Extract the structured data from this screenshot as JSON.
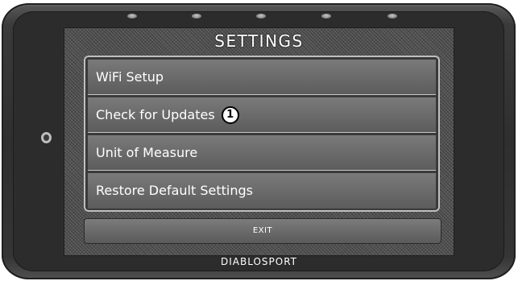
{
  "screen": {
    "title": "SETTINGS",
    "menu_items": [
      {
        "label": "WiFi Setup"
      },
      {
        "label": "Check for Updates",
        "callout": "1"
      },
      {
        "label": "Unit of Measure"
      },
      {
        "label": "Restore Default Settings"
      }
    ],
    "exit_label": "EXIT"
  },
  "device": {
    "brand": "DIABLOSPORT",
    "led_count": 5
  }
}
